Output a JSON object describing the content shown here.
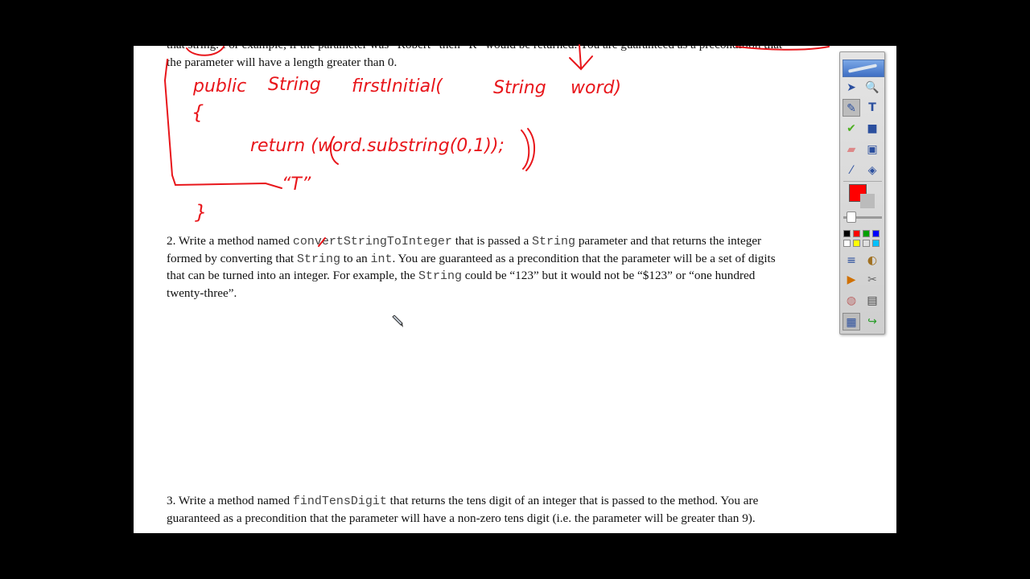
{
  "document": {
    "top_line_1": "that string. For example, if the parameter was “Robert” then “R” would be returned. You are guaranteed as a precondition that",
    "top_line_2": "the parameter will have a length greater than 0.",
    "q2": {
      "num": "2. Write a method named ",
      "method": "convertStringToInteger",
      "t1": " that is passed a ",
      "type1": "String",
      "t2": " parameter and that returns the integer",
      "l2a": "formed by converting that ",
      "type2": "String",
      "l2b": " to an ",
      "type3": "int",
      "l2c": ". You are guaranteed as a precondition that the parameter will be a set of digits",
      "l3a": "that can be turned into an integer. For example, the ",
      "type4": "String",
      "l3b": " could be “123” but it would not be “$123” or “one hundred",
      "l4": "twenty-three”."
    },
    "q3": {
      "num": "3. Write a method named ",
      "method": "findTensDigit",
      "t1": " that returns the tens digit of an integer that is passed to the method. You are",
      "l2": "guaranteed as a precondition that the parameter will have a non-zero tens digit (i.e. the parameter will be greater than 9)."
    }
  },
  "handwriting": {
    "line1": [
      "public",
      "String",
      "firstInitial(",
      "String",
      "word)"
    ],
    "brace_open": "{",
    "line2": "return (word.substring(0,1));",
    "annotation": "“T”",
    "brace_close": "}"
  },
  "toolbar": {
    "tools": [
      "select-icon",
      "zoom-icon",
      "pen-icon",
      "text-icon",
      "highlighter-icon",
      "shape-icon",
      "eraser-icon",
      "image-icon",
      "pipette-icon",
      "fill-icon"
    ],
    "current_color": "#ff0000",
    "palette": [
      "#000000",
      "#ff0000",
      "#00a000",
      "#0000ff",
      "#ffffff",
      "#ffff00",
      "#e0e0e0",
      "#00c0ff"
    ]
  },
  "colors": {
    "ink": "#e8161b",
    "background": "#000000",
    "page": "#ffffff"
  }
}
